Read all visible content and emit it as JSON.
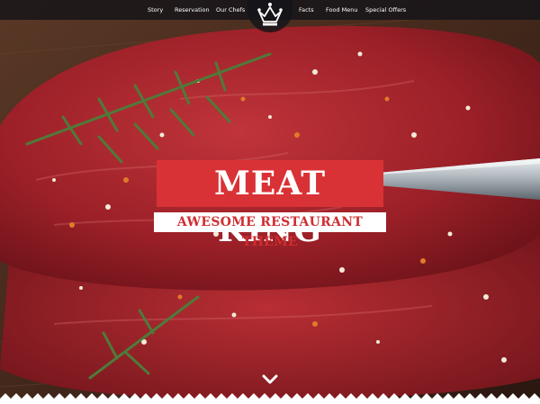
{
  "nav": {
    "items_left": [
      {
        "label": "Story"
      },
      {
        "label": "Reservation"
      },
      {
        "label": "Our Chefs"
      }
    ],
    "items_right": [
      {
        "label": "Facts"
      },
      {
        "label": "Food Menu"
      },
      {
        "label": "Special Offers"
      }
    ],
    "logo_icon": "crown-icon"
  },
  "hero": {
    "title": "MEAT KING",
    "subtitle": "AWESOME RESTAURANT THEME",
    "scroll_icon": "chevron-down-icon"
  },
  "colors": {
    "accent_red": "#d93236",
    "nav_bg": "#141418",
    "meat": "#a1242b",
    "board": "#4a2b1c"
  }
}
